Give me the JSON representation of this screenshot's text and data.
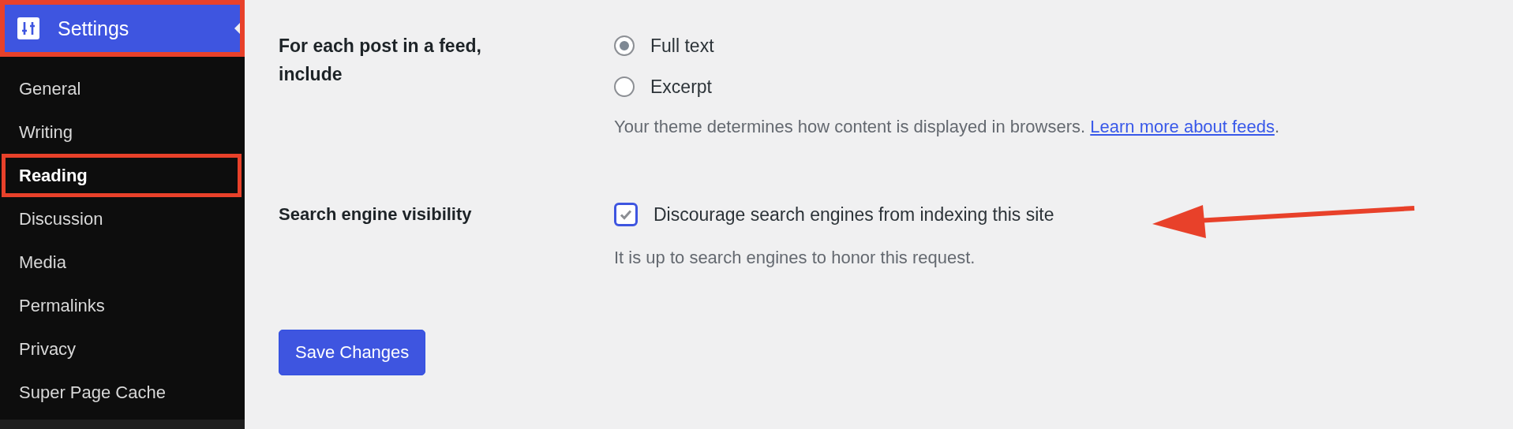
{
  "sidebar": {
    "header": {
      "label": "Settings",
      "selected": true,
      "highlighted": true
    },
    "items": [
      {
        "label": "General",
        "selected": false,
        "highlighted": false
      },
      {
        "label": "Writing",
        "selected": false,
        "highlighted": false
      },
      {
        "label": "Reading",
        "selected": true,
        "highlighted": true
      },
      {
        "label": "Discussion",
        "selected": false,
        "highlighted": false
      },
      {
        "label": "Media",
        "selected": false,
        "highlighted": false
      },
      {
        "label": "Permalinks",
        "selected": false,
        "highlighted": false
      },
      {
        "label": "Privacy",
        "selected": false,
        "highlighted": false
      },
      {
        "label": "Super Page Cache",
        "selected": false,
        "highlighted": false
      }
    ]
  },
  "feed": {
    "label": "For each post in a feed, include",
    "options": [
      {
        "label": "Full text",
        "selected": true
      },
      {
        "label": "Excerpt",
        "selected": false
      }
    ],
    "description": "Your theme determines how content is displayed in browsers.",
    "link": "Learn more about feeds",
    "link_suffix": "."
  },
  "visibility": {
    "label": "Search engine visibility",
    "checkbox": {
      "label": "Discourage search engines from indexing this site",
      "checked": true
    },
    "description": "It is up to search engines to honor this request."
  },
  "save_button": "Save Changes"
}
